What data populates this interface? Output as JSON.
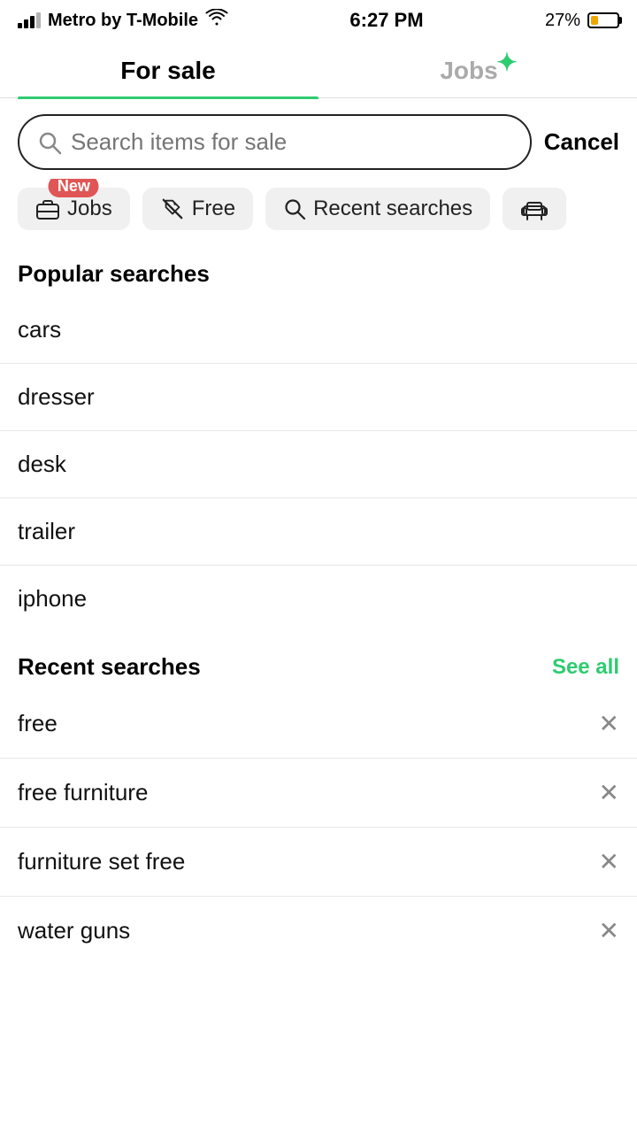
{
  "statusBar": {
    "carrier": "Metro by T-Mobile",
    "time": "6:27 PM",
    "battery": "27%",
    "batteryLevel": 27
  },
  "tabs": [
    {
      "id": "for-sale",
      "label": "For sale",
      "active": true
    },
    {
      "id": "jobs",
      "label": "Jobs",
      "active": false
    }
  ],
  "sparkle": "✦",
  "search": {
    "placeholder": "Search items for sale",
    "cancelLabel": "Cancel"
  },
  "chips": [
    {
      "id": "jobs",
      "icon": "briefcase",
      "label": "Jobs",
      "badge": "New"
    },
    {
      "id": "free",
      "icon": "tag-slash",
      "label": "Free",
      "badge": null
    },
    {
      "id": "recent-searches",
      "icon": "search",
      "label": "Recent searches",
      "badge": null
    },
    {
      "id": "furniture",
      "icon": "sofa",
      "label": "",
      "badge": null
    }
  ],
  "popularSearches": {
    "title": "Popular searches",
    "items": [
      "cars",
      "dresser",
      "desk",
      "trailer",
      "iphone"
    ]
  },
  "recentSearches": {
    "title": "Recent searches",
    "seeAllLabel": "See all",
    "items": [
      "free",
      "free furniture",
      "furniture set free",
      "water guns"
    ]
  }
}
